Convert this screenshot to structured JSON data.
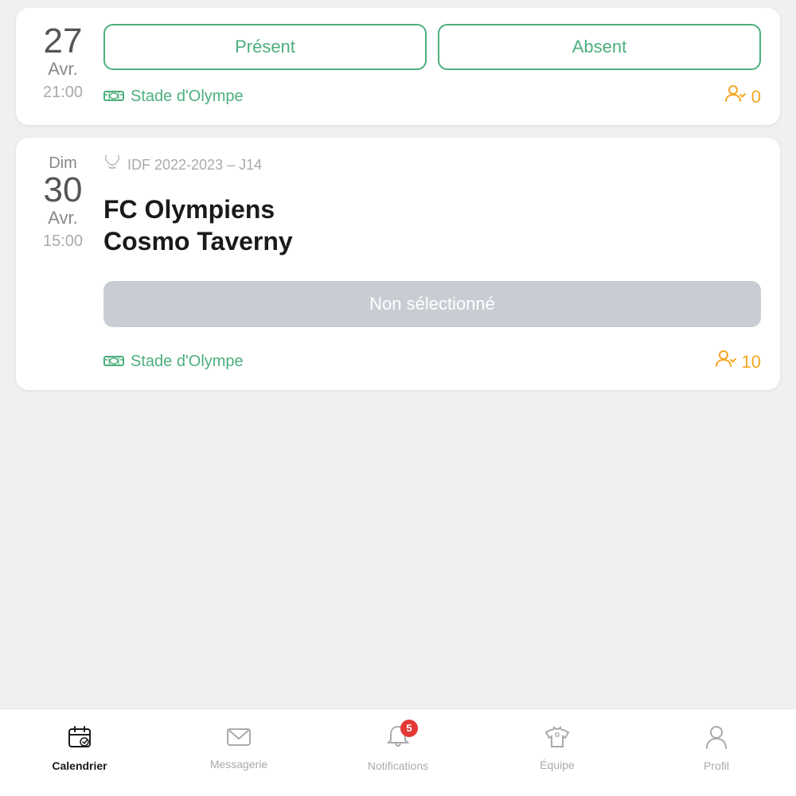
{
  "card1": {
    "date": {
      "day_name": "",
      "day_num": "27",
      "month": "Avr.",
      "time": "21:00"
    },
    "buttons": {
      "present": "Présent",
      "absent": "Absent"
    },
    "venue": "Stade d'Olympe",
    "attendance_count": "0"
  },
  "card2": {
    "date": {
      "day_name": "Dim",
      "day_num": "30",
      "month": "Avr.",
      "time": "15:00"
    },
    "league": "IDF 2022-2023 – J14",
    "team1": "FC Olympiens",
    "team2": "Cosmo Taverny",
    "status_button": "Non sélectionné",
    "venue": "Stade d'Olympe",
    "attendance_count": "10"
  },
  "bottom_nav": {
    "items": [
      {
        "id": "calendrier",
        "label": "Calendrier",
        "active": true
      },
      {
        "id": "messagerie",
        "label": "Messagerie",
        "active": false
      },
      {
        "id": "notifications",
        "label": "Notifications",
        "active": false,
        "badge": "5"
      },
      {
        "id": "equipe",
        "label": "Équipe",
        "active": false
      },
      {
        "id": "profil",
        "label": "Profil",
        "active": false
      }
    ]
  },
  "colors": {
    "green": "#4caf7d",
    "yellow": "#f5a623",
    "red": "#e53935",
    "gray_btn": "#c8cdd4"
  }
}
